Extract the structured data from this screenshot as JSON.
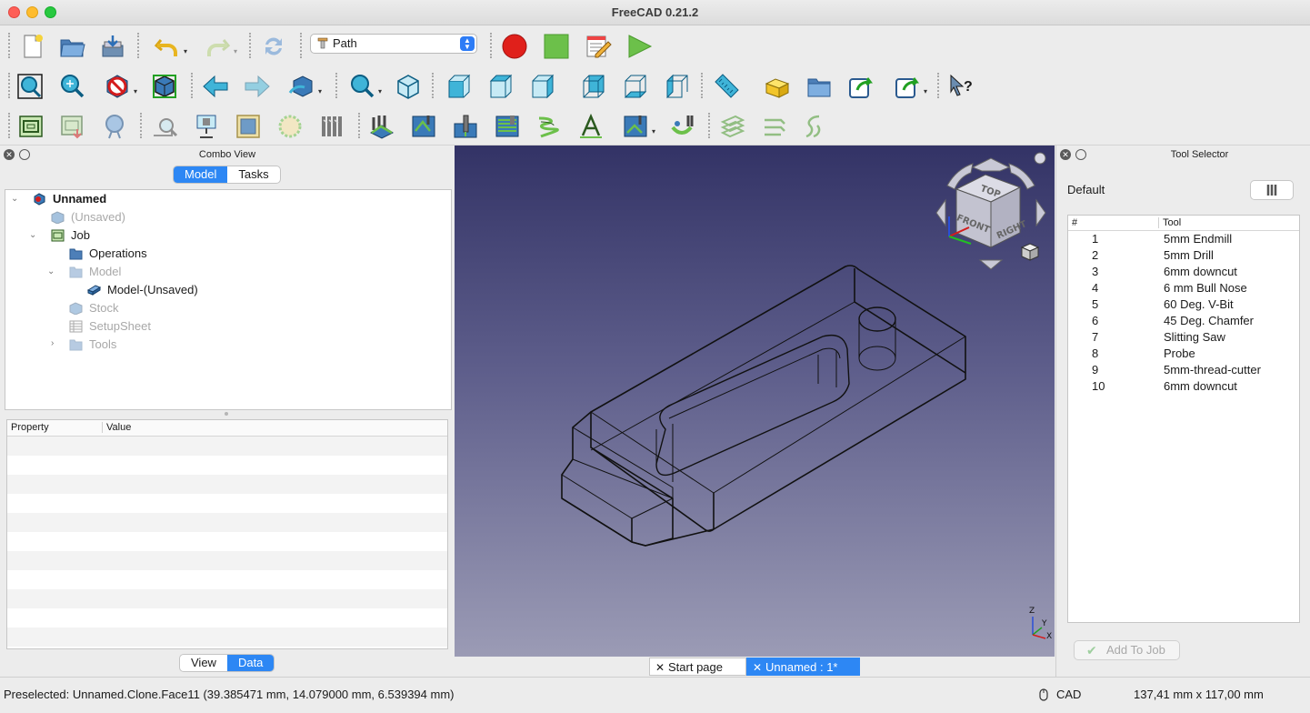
{
  "window": {
    "title": "FreeCAD 0.21.2"
  },
  "toolbar": {
    "workbench_label": "Path",
    "row1_icons": [
      "new-document-icon",
      "open-icon",
      "save-icon",
      "undo-icon",
      "redo-icon",
      "refresh-icon",
      "record-macro-icon",
      "stop-macro-icon",
      "macro-editor-icon",
      "run-macro-icon"
    ],
    "row2_icons": [
      "fit-all-icon",
      "fit-selection-icon",
      "draw-style-icon",
      "bounding-box-icon",
      "back-arrow-icon",
      "forward-arrow-icon",
      "std-views-icon",
      "zoom-icon",
      "isometric-icon",
      "front-view-icon",
      "top-view-icon",
      "right-view-icon",
      "rear-view-icon",
      "bottom-view-icon",
      "left-view-icon",
      "measure-icon",
      "part-icon",
      "group-icon",
      "link-icon",
      "link-actions-icon",
      "whats-this-icon"
    ],
    "row3_icons": [
      "job-icon",
      "post-process-icon",
      "sanity-icon",
      "inspect-icon",
      "simulator-icon",
      "stock-icon",
      "drilling-circle-icon",
      "tool-bits-icon",
      "profile-icon",
      "pocket-icon",
      "drill-icon",
      "face-icon",
      "helix-icon",
      "engrave-icon",
      "adaptive-icon",
      "dressup-icon",
      "array-icon",
      "copy-icon",
      "deburr-icon"
    ]
  },
  "combo_view": {
    "title": "Combo View",
    "tabs": [
      {
        "label": "Model",
        "active": true
      },
      {
        "label": "Tasks",
        "active": false
      }
    ],
    "tree": [
      {
        "label": "Unnamed",
        "bold": true,
        "greyed": false,
        "icon": "document-icon"
      },
      {
        "label": "(Unsaved)",
        "bold": false,
        "greyed": true,
        "icon": "clone-icon"
      },
      {
        "label": "Job",
        "bold": false,
        "greyed": false,
        "icon": "job-icon"
      },
      {
        "label": "Operations",
        "bold": false,
        "greyed": false,
        "icon": "folder-icon"
      },
      {
        "label": "Model",
        "bold": false,
        "greyed": true,
        "icon": "folder-icon"
      },
      {
        "label": "Model-(Unsaved)",
        "bold": false,
        "greyed": false,
        "icon": "solid-icon"
      },
      {
        "label": "Stock",
        "bold": false,
        "greyed": true,
        "icon": "stock-icon"
      },
      {
        "label": "SetupSheet",
        "bold": false,
        "greyed": true,
        "icon": "sheet-icon"
      },
      {
        "label": "Tools",
        "bold": false,
        "greyed": true,
        "icon": "folder-icon"
      }
    ],
    "property_header": {
      "property": "Property",
      "value": "Value"
    },
    "bottom_tabs": [
      {
        "label": "View",
        "active": false
      },
      {
        "label": "Data",
        "active": true
      }
    ]
  },
  "view3d": {
    "navcube_faces": {
      "top": "TOP",
      "front": "FRONT",
      "right": "RIGHT"
    },
    "axis_labels": {
      "z": "Z",
      "y": "Y",
      "x": "X"
    },
    "background_top": "#333366",
    "background_bottom": "#9b9bb5"
  },
  "doc_tabs": [
    {
      "label": "Start page",
      "active": false
    },
    {
      "label": "Unnamed : 1*",
      "active": true
    }
  ],
  "tool_selector": {
    "title": "Tool Selector",
    "library": "Default",
    "columns": {
      "number": "#",
      "tool": "Tool"
    },
    "tools": [
      {
        "number": "1",
        "name": "5mm Endmill"
      },
      {
        "number": "2",
        "name": "5mm Drill"
      },
      {
        "number": "3",
        "name": "6mm downcut"
      },
      {
        "number": "4",
        "name": "6 mm Bull Nose"
      },
      {
        "number": "5",
        "name": "60 Deg. V-Bit"
      },
      {
        "number": "6",
        "name": "45 Deg. Chamfer"
      },
      {
        "number": "7",
        "name": "Slitting Saw"
      },
      {
        "number": "8",
        "name": "Probe"
      },
      {
        "number": "9",
        "name": "5mm-thread-cutter"
      },
      {
        "number": "10",
        "name": "6mm downcut"
      }
    ],
    "add_button": "Add To Job"
  },
  "status": {
    "preselected": "Preselected: Unnamed.Clone.Face11 (39.385471 mm, 14.079000 mm, 6.539394 mm)",
    "nav_style": "CAD",
    "dimensions": "137,41 mm x 117,00 mm"
  },
  "colors": {
    "accent": "#2d87f4",
    "record": "#e0201b",
    "stop": "#6cc04a",
    "run": "#6cc04a"
  }
}
